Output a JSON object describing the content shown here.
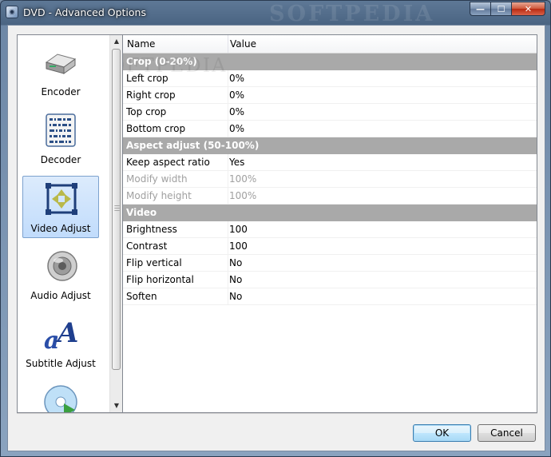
{
  "window": {
    "title": "DVD - Advanced Options",
    "watermark": "SOFTPEDIA"
  },
  "titlebar": {
    "minimize": "—",
    "maximize": "☐",
    "close": "✕"
  },
  "sidebar": {
    "items": [
      {
        "label": "Encoder",
        "icon": "encoder-icon",
        "selected": false
      },
      {
        "label": "Decoder",
        "icon": "decoder-icon",
        "selected": false
      },
      {
        "label": "Video Adjust",
        "icon": "video-adjust-icon",
        "selected": true
      },
      {
        "label": "Audio Adjust",
        "icon": "speaker-icon",
        "selected": false
      },
      {
        "label": "Subtitle Adjust",
        "icon": "subtitle-icon",
        "selected": false
      },
      {
        "label": "",
        "icon": "disc-icon",
        "selected": false
      }
    ]
  },
  "grid": {
    "columns": {
      "name": "Name",
      "value": "Value"
    },
    "watermark": "SOFTPEDIA",
    "rows": [
      {
        "type": "category",
        "name": "Crop (0-20%)"
      },
      {
        "type": "property",
        "name": "Left crop",
        "value": "0%",
        "disabled": false
      },
      {
        "type": "property",
        "name": "Right crop",
        "value": "0%",
        "disabled": false
      },
      {
        "type": "property",
        "name": "Top crop",
        "value": "0%",
        "disabled": false
      },
      {
        "type": "property",
        "name": "Bottom crop",
        "value": "0%",
        "disabled": false
      },
      {
        "type": "category",
        "name": "Aspect adjust (50-100%)"
      },
      {
        "type": "property",
        "name": "Keep aspect ratio",
        "value": "Yes",
        "disabled": false
      },
      {
        "type": "property",
        "name": "Modify width",
        "value": "100%",
        "disabled": true
      },
      {
        "type": "property",
        "name": "Modify height",
        "value": "100%",
        "disabled": true
      },
      {
        "type": "category",
        "name": "Video"
      },
      {
        "type": "property",
        "name": "Brightness",
        "value": "100",
        "disabled": false
      },
      {
        "type": "property",
        "name": "Contrast",
        "value": "100",
        "disabled": false
      },
      {
        "type": "property",
        "name": "Flip vertical",
        "value": "No",
        "disabled": false
      },
      {
        "type": "property",
        "name": "Flip horizontal",
        "value": "No",
        "disabled": false
      },
      {
        "type": "property",
        "name": "Soften",
        "value": "No",
        "disabled": false
      }
    ]
  },
  "buttons": {
    "ok": "OK",
    "cancel": "Cancel"
  },
  "colors": {
    "category_header": "#a9a9a9",
    "selection": "#c1dcfc",
    "disabled_text": "#a0a0a0"
  }
}
